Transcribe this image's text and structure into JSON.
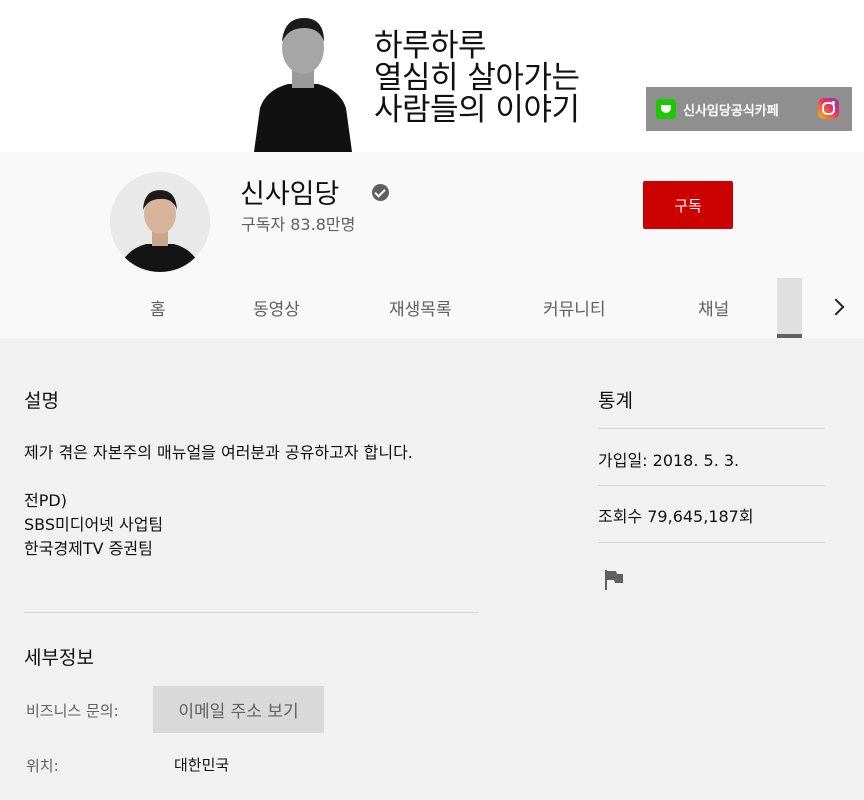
{
  "banner": {
    "lines": [
      "하루하루",
      "열심히 살아가는",
      "사람들의 이야기"
    ],
    "cafe_label": "신사임당공식카페",
    "insta_icon": "instagram-icon"
  },
  "channel": {
    "name": "신사임당",
    "subscribers": "구독자 83.8만명",
    "subscribe_label": "구독",
    "subscribe_color": "#cc0000"
  },
  "tabs": [
    "홈",
    "동영상",
    "재생목록",
    "커뮤니티",
    "채널"
  ],
  "about": {
    "description_title": "설명",
    "description": "제가 겪은 자본주의 매뉴얼을 여러분과 공유하고자 합니다.\n\n전PD)\nSBS미디어넷 사업팀\n한국경제TV 증권팀",
    "details_title": "세부정보",
    "business_label": "비즈니스 문의:",
    "email_button": "이메일 주소 보기",
    "location_label": "위치:",
    "location": "대한민국"
  },
  "stats": {
    "title": "통계",
    "joined": "가입일: 2018. 5. 3.",
    "views": "조회수 79,645,187회"
  }
}
